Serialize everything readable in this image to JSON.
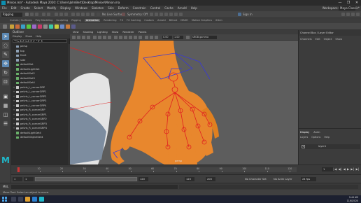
{
  "window": {
    "title": "Minion.ma* - Autodesk Maya 2020: C:\\Users\\JohnBert\\Desktop\\Minion\\Minion.ma",
    "min": "—",
    "max": "❐",
    "close": "✕"
  },
  "menubar": {
    "items": [
      "File",
      "Edit",
      "Create",
      "Select",
      "Modify",
      "Display",
      "Windows",
      "Skeleton",
      "Skin",
      "Deform",
      "Constrain",
      "Control",
      "Cache",
      "Arnold",
      "Help"
    ],
    "workspace_label": "Workspace:",
    "workspace_value": "Maya Classic*"
  },
  "statusline": {
    "mode": "Rigging",
    "no_live_surface": "No Live Surface",
    "symmetry": "Symmetry: Off",
    "sign_in": "Sign In"
  },
  "shelf_tabs": [
    "Curves / Surfaces",
    "Poly Modeling",
    "Sculpting",
    "Rigging",
    "Animation",
    "Rendering",
    "FX",
    "FX Caching",
    "Custom",
    "Arnold",
    "Bifrost",
    "MASH",
    "Motion Graphics",
    "XGen"
  ],
  "shelf_active": "Animation",
  "toolbox": {
    "tools": [
      "select-arrow",
      "lasso",
      "paint-select",
      "move",
      "rotate",
      "scale"
    ],
    "logo": "M"
  },
  "outliner": {
    "title": "Outliner",
    "menu": [
      "Display",
      "Show",
      "Help"
    ],
    "search_placeholder": "Search...",
    "items": [
      {
        "label": "persp",
        "type": "camera"
      },
      {
        "label": "top",
        "type": "camera"
      },
      {
        "label": "front",
        "type": "camera"
      },
      {
        "label": "side",
        "type": "camera"
      },
      {
        "label": "defaultSet",
        "type": "set"
      },
      {
        "label": "defaultLightSet",
        "type": "set"
      },
      {
        "label": "defaultSet2",
        "type": "set"
      },
      {
        "label": "defaultSet3",
        "type": "set"
      },
      {
        "label": "defaultSet4",
        "type": "set"
      },
      {
        "label": "pelvis_L_cornerGRP",
        "type": "group"
      },
      {
        "label": "pelvis_L_cornerGRP1",
        "type": "group"
      },
      {
        "label": "pelvis_L_cornerGRP2",
        "type": "group"
      },
      {
        "label": "pelvis_L_cornerGRP3",
        "type": "group"
      },
      {
        "label": "pelvis_L_cornerGRP4",
        "type": "group"
      },
      {
        "label": "pelvis_R_cornerGRP",
        "type": "group"
      },
      {
        "label": "pelvis_R_cornerGRP1",
        "type": "group"
      },
      {
        "label": "pelvis_R_cornerGRP2",
        "type": "group"
      },
      {
        "label": "pelvis_R_cornerGRP3",
        "type": "group"
      },
      {
        "label": "pelvis_R_cornerGRP4",
        "type": "group"
      },
      {
        "label": "defaultLightSet4",
        "type": "set"
      },
      {
        "label": "defaultObjectSet4",
        "type": "set"
      }
    ]
  },
  "viewport": {
    "menu": [
      "View",
      "Shading",
      "Lighting",
      "Show",
      "Renderer",
      "Panels"
    ],
    "near_value": "0.00",
    "far_value": "1.00",
    "color_space": "sRGB gamma",
    "camera": "persp"
  },
  "channelbox": {
    "title": "Channel Box / Layer Editor",
    "menu": [
      "Channels",
      "Edit",
      "Object",
      "Show"
    ]
  },
  "layereditor": {
    "tabs": [
      "Display",
      "Anim"
    ],
    "active_tab": "Display",
    "menu": [
      "Layers",
      "Options",
      "Help"
    ],
    "layer_visible": "V",
    "layer_name": "layer1"
  },
  "timeslider": {
    "ticks": [
      "10",
      "20",
      "30",
      "40",
      "50",
      "60",
      "70",
      "80",
      "90",
      "100",
      "110",
      "120"
    ],
    "current_frame": "1",
    "playback": "|◀ ◀| ◀ ▶ ▶| ▶|"
  },
  "rangeslider": {
    "start": "1",
    "start_inner": "1",
    "end_inner": "120",
    "end": "120",
    "end_outer": "200",
    "char_set": "No Character Set",
    "anim_layer": "No Anim Layer",
    "fps": "24 fps"
  },
  "cmdline": {
    "label": "MEL"
  },
  "helpline": {
    "text": "Move Tool: Select an object to move."
  },
  "taskbar": {
    "time": "9:44 AM",
    "date": "11/6/2020"
  },
  "colors": {
    "accent": "#5c89b4",
    "skin": "#e88a2e",
    "joint": "#e02020",
    "control": "#3b3be0"
  }
}
